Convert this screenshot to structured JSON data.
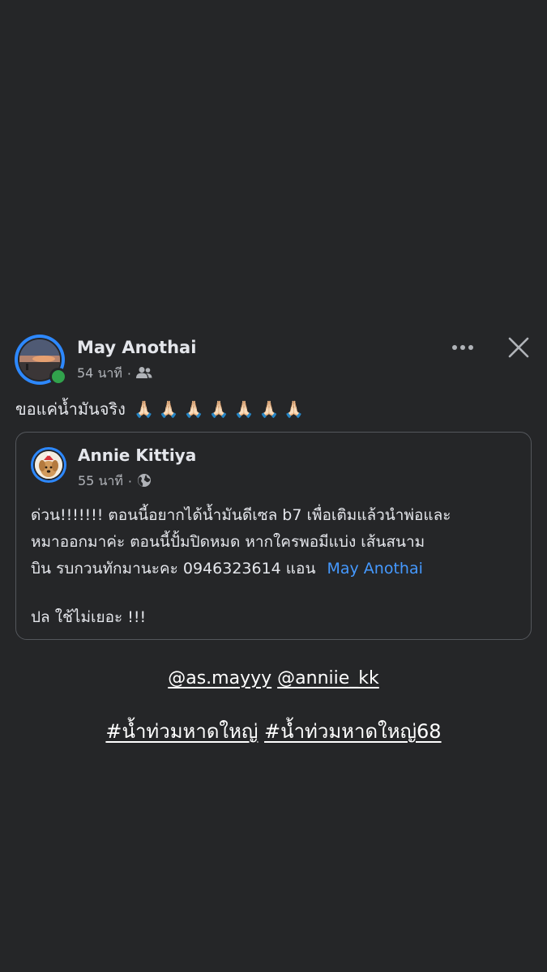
{
  "post": {
    "author": "May Anothai",
    "time": "54 นาที",
    "separator": "·",
    "audience_icon": "friends-icon",
    "text": "ขอแค่น้ำมันจริง",
    "emojis": "🙏🏻🙏🏻🙏🏻🙏🏻🙏🏻🙏🏻🙏🏻",
    "online": true
  },
  "shared_post": {
    "author": "Annie Kittiya",
    "time": "55 นาที",
    "separator": "·",
    "audience_icon": "globe-icon",
    "lines": [
      "ด่วน!!!!!!! ตอนนี้อยากได้น้ำมันดีเซล b7 เพื่อเติมแล้วนำพ่อและ",
      "หมาออกมาค่ะ  ตอนนี้ปั้มปิดหมด หากใครพอมีแบ่ง เส้นสนาม",
      "บิน รบกวนทักมานะคะ 0946323614 แอน"
    ],
    "mention": "May Anothai",
    "footer": "ปล ใช้ไม่เยอะ !!!"
  },
  "story_tags": {
    "mentions": [
      "@as.mayyy",
      "@anniie_kk"
    ],
    "hashtags": [
      "#น้ำท่วมหาดใหญ่",
      "#น้ำท่วมหาดใหญ่68"
    ]
  },
  "colors": {
    "background": "#252628",
    "link": "#4599ff",
    "online": "#31a24c",
    "ring": "#2d88ff"
  }
}
